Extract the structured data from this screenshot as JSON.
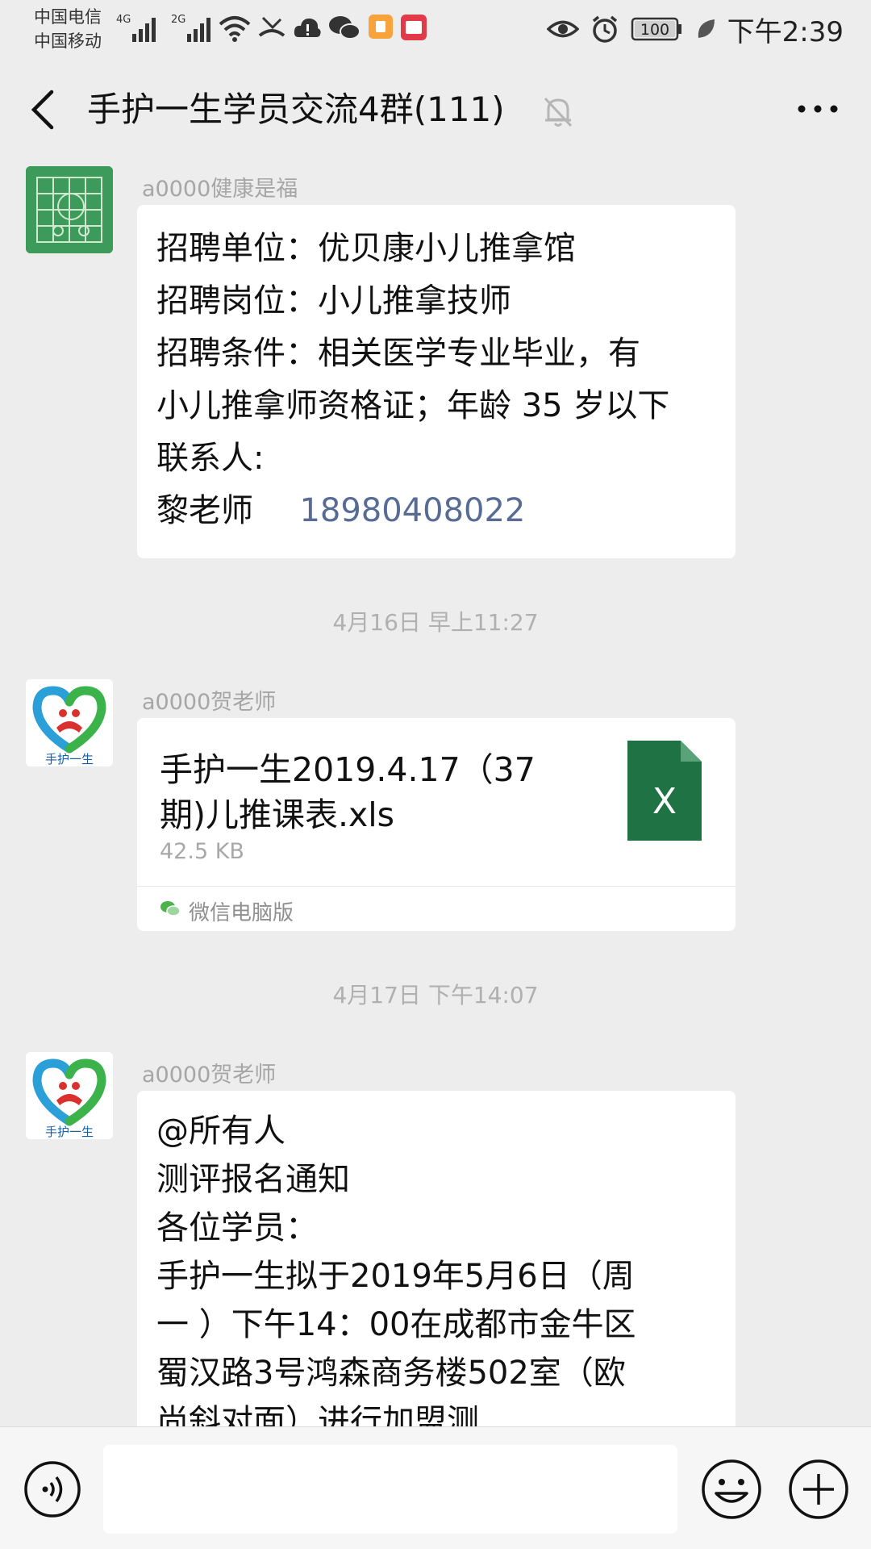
{
  "status_bar": {
    "carrier_1": "中国电信",
    "carrier_2": "中国移动",
    "net_1": "4G",
    "net_2": "2G",
    "battery": "100",
    "time": "下午2:39"
  },
  "header": {
    "title": "手护一生学员交流4群(111)"
  },
  "messages": [
    {
      "sender": "a0000健康是福",
      "lines": [
        "招聘单位：优贝康小儿推拿馆",
        "招聘岗位：小儿推拿技师",
        "招聘条件：相关医学专业毕业，有",
        "小儿推拿师资格证；年龄 35 岁以下",
        "联系人:"
      ],
      "contact_name": "黎老师",
      "contact_phone": "18980408022"
    },
    {
      "timestamp": "4月16日 早上11:27",
      "sender": "a0000贺老师",
      "file_name_line1": "手护一生2019.4.17（37",
      "file_name_line2": "期)儿推课表.xls",
      "file_size": "42.5 KB",
      "file_icon_letter": "X",
      "source": "微信电脑版"
    },
    {
      "timestamp": "4月17日 下午14:07",
      "sender": "a0000贺老师",
      "lines": [
        "@所有人",
        "测评报名通知",
        "各位学员：",
        "手护一生拟于2019年5月6日（周",
        "一 ）下午14：00在成都市金牛区",
        "蜀汉路3号鸿森商务楼502室（欧",
        "尚斜对面）进行加盟测"
      ]
    }
  ],
  "logo_text": "手护一生",
  "colors": {
    "background": "#ededed",
    "bubble": "#ffffff",
    "link": "#576b95",
    "excel_green": "#1f7244"
  }
}
